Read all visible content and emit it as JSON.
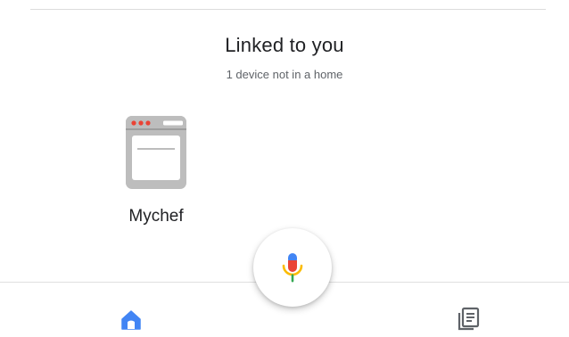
{
  "linked_section": {
    "title": "Linked to you",
    "subtitle": "1 device not in a home"
  },
  "devices": [
    {
      "label": "Mychef",
      "icon": "oven-icon"
    }
  ],
  "assistant": {
    "icon": "microphone-icon"
  },
  "bottom_nav": {
    "items": [
      {
        "icon": "home-icon",
        "active": true
      },
      {
        "icon": "feed-icon",
        "active": false
      }
    ]
  },
  "colors": {
    "accent_blue": "#4285F4",
    "google_red": "#EA4335",
    "google_yellow": "#FBBC05",
    "google_green": "#34A853",
    "icon_gray": "#5f6368",
    "appliance_gray": "#bdbdbd"
  }
}
